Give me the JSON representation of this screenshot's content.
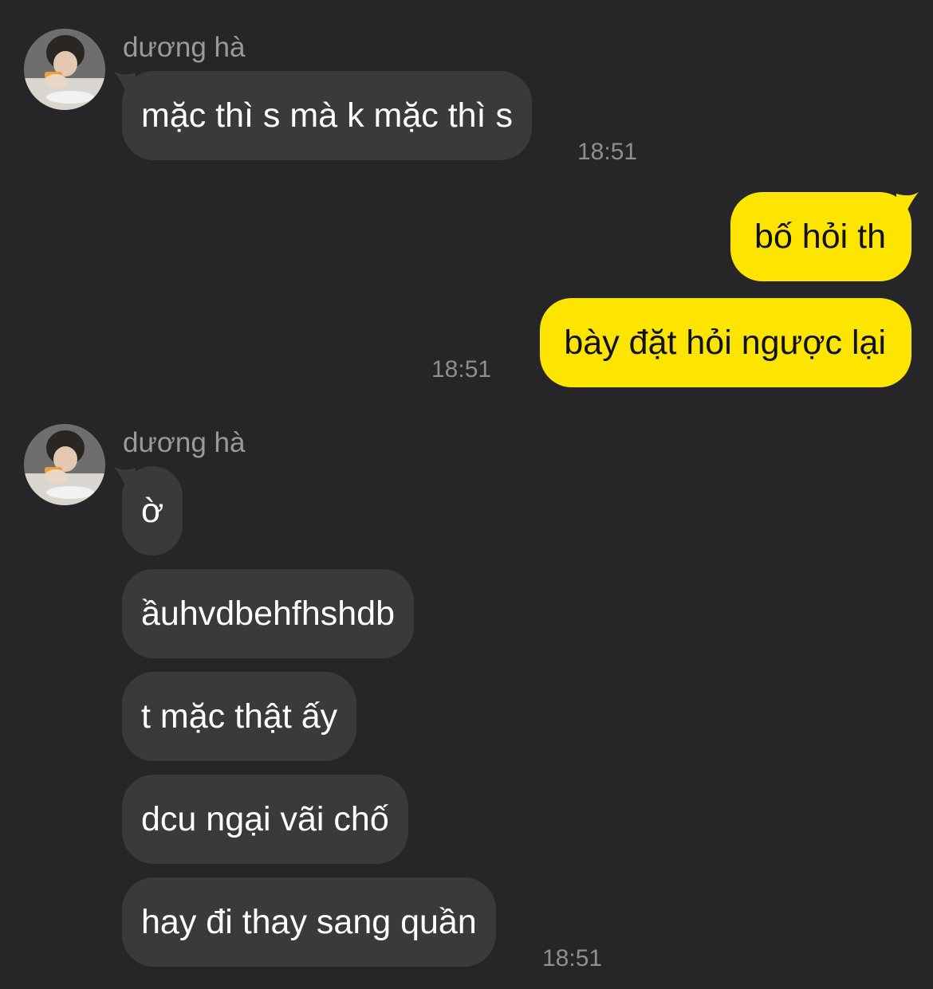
{
  "colors": {
    "background": "#262628",
    "incoming_bubble": "#3a3a3c",
    "outgoing_bubble": "#fee500",
    "sender_name": "#9a9a9a",
    "timestamp": "#8e8e90"
  },
  "groups": [
    {
      "direction": "incoming",
      "sender": "dương hà",
      "avatar": "profile-photo-icon",
      "messages": [
        "mặc thì s mà k mặc thì s"
      ],
      "time": "18:51"
    },
    {
      "direction": "outgoing",
      "messages": [
        "bố hỏi th",
        "bày đặt hỏi ngược lại"
      ],
      "time": "18:51"
    },
    {
      "direction": "incoming",
      "sender": "dương hà",
      "avatar": "profile-photo-icon",
      "messages": [
        "ờ",
        "ầuhvdbehfhshdb",
        "t mặc thật ấy",
        "dcu ngại vãi chố",
        "hay đi thay sang quần"
      ],
      "time": "18:51"
    }
  ]
}
